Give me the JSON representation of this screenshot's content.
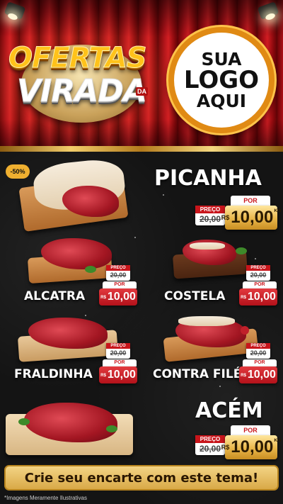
{
  "header": {
    "promo_word_1": "OFERTAS",
    "promo_word_2": "VIRADA",
    "promo_small": "DA",
    "logo_line_1": "SUA",
    "logo_line_2": "LOGO",
    "logo_line_3": "AQUI"
  },
  "discount_badge": "-50%",
  "price_labels": {
    "old": "PREÇO",
    "new": "POR",
    "currency": "R$",
    "unit": "KG"
  },
  "products": [
    {
      "name": "PICANHA",
      "old_price": "20,00",
      "new_price": "10,00"
    },
    {
      "name": "ALCATRA",
      "old_price": "20,00",
      "new_price": "10,00"
    },
    {
      "name": "COSTELA",
      "old_price": "20,00",
      "new_price": "10,00"
    },
    {
      "name": "FRALDINHA",
      "old_price": "20,00",
      "new_price": "10,00"
    },
    {
      "name": "CONTRA FILÉ",
      "old_price": "20,00",
      "new_price": "10,00"
    },
    {
      "name": "ACÉM",
      "old_price": "20,00",
      "new_price": "10,00"
    }
  ],
  "cta_label": "Crie seu encarte com este tema!",
  "footnote": "*Imagens Meramente Ilustrativas",
  "colors": {
    "curtain_red": "#b3121a",
    "gold": "#e9b64a",
    "price_red": "#c8151b",
    "logo_ring": "#e08a14"
  }
}
